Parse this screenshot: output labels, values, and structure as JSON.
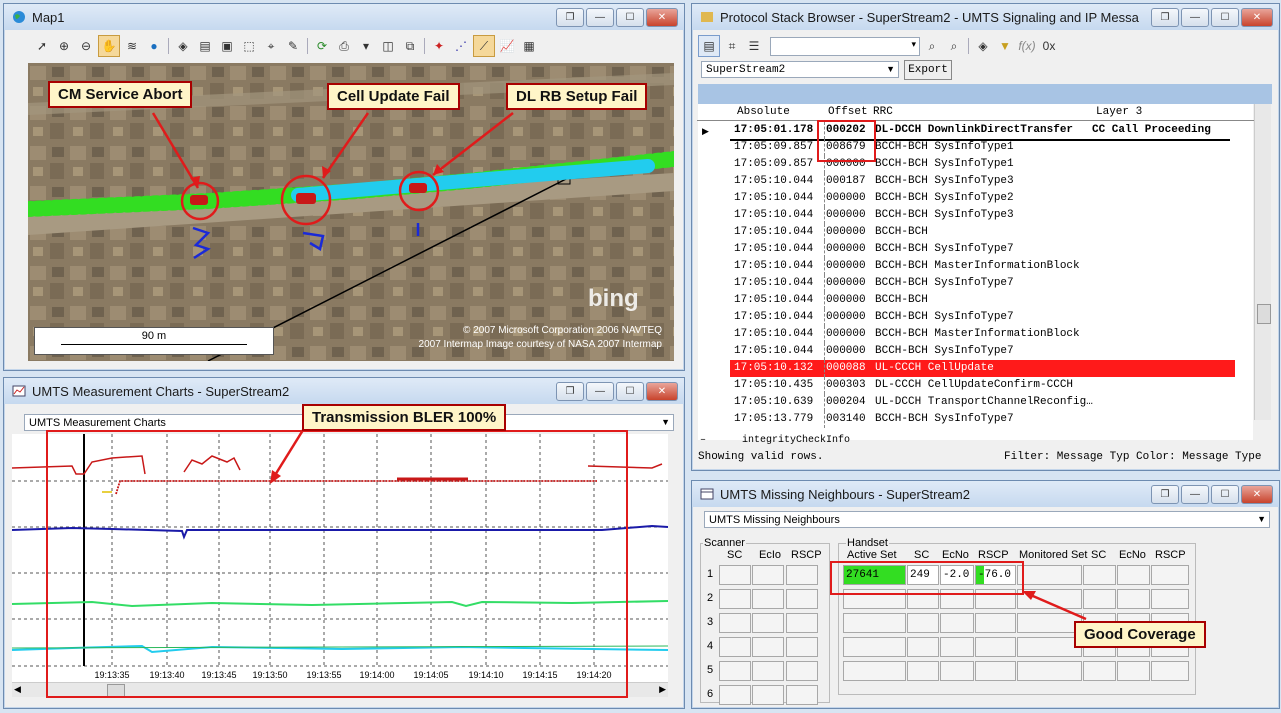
{
  "map_window": {
    "title": "Map1",
    "scale_label": "90 m",
    "bing": "bing",
    "copyright_1": "© 2007 Microsoft Corporation   2006 NAVTEQ",
    "copyright_2": "2007 Intermap  Image courtesy of NASA   2007 Intermap",
    "callouts": [
      "CM Service Abort",
      "Cell Update Fail",
      "DL RB Setup Fail"
    ]
  },
  "stack_window": {
    "title": "Protocol Stack Browser  -  SuperStream2  -  UMTS Signaling and IP Messa",
    "stream_select": "SuperStream2",
    "export_label": "Export",
    "columns": [
      "Absolute",
      "Offset",
      "RRC",
      "Layer 3"
    ],
    "rows": [
      {
        "time": "17:05:01.178",
        "offset": "000202",
        "rrc": "DL-DCCH DownlinkDirectTransfer",
        "l3": "CC Call Proceeding"
      },
      {
        "time": "17:05:09.857",
        "offset": "008679",
        "rrc": "BCCH-BCH SysInfoType1",
        "l3": ""
      },
      {
        "time": "17:05:09.857",
        "offset": "000000",
        "rrc": "BCCH-BCH SysInfoType1",
        "l3": ""
      },
      {
        "time": "17:05:10.044",
        "offset": "000187",
        "rrc": "BCCH-BCH SysInfoType3",
        "l3": ""
      },
      {
        "time": "17:05:10.044",
        "offset": "000000",
        "rrc": "BCCH-BCH SysInfoType2",
        "l3": ""
      },
      {
        "time": "17:05:10.044",
        "offset": "000000",
        "rrc": "BCCH-BCH SysInfoType3",
        "l3": ""
      },
      {
        "time": "17:05:10.044",
        "offset": "000000",
        "rrc": "BCCH-BCH",
        "l3": ""
      },
      {
        "time": "17:05:10.044",
        "offset": "000000",
        "rrc": "BCCH-BCH SysInfoType7",
        "l3": ""
      },
      {
        "time": "17:05:10.044",
        "offset": "000000",
        "rrc": "BCCH-BCH MasterInformationBlock",
        "l3": ""
      },
      {
        "time": "17:05:10.044",
        "offset": "000000",
        "rrc": "BCCH-BCH SysInfoType7",
        "l3": ""
      },
      {
        "time": "17:05:10.044",
        "offset": "000000",
        "rrc": "BCCH-BCH",
        "l3": ""
      },
      {
        "time": "17:05:10.044",
        "offset": "000000",
        "rrc": "BCCH-BCH SysInfoType7",
        "l3": ""
      },
      {
        "time": "17:05:10.044",
        "offset": "000000",
        "rrc": "BCCH-BCH MasterInformationBlock",
        "l3": ""
      },
      {
        "time": "17:05:10.044",
        "offset": "000000",
        "rrc": "BCCH-BCH SysInfoType7",
        "l3": ""
      },
      {
        "time": "17:05:10.132",
        "offset": "000088",
        "rrc": "UL-CCCH CellUpdate",
        "l3": ""
      },
      {
        "time": "17:05:10.435",
        "offset": "000303",
        "rrc": "DL-CCCH CellUpdateConfirm-CCCH",
        "l3": ""
      },
      {
        "time": "17:05:10.639",
        "offset": "000204",
        "rrc": "UL-DCCH  TransportChannelReconfig…",
        "l3": ""
      },
      {
        "time": "17:05:13.779",
        "offset": "003140",
        "rrc": "BCCH-BCH SysInfoType7",
        "l3": ""
      }
    ],
    "detail_line": "–      integrityCheckInfo",
    "status_left": "Showing valid rows.",
    "status_right": "Filter: Message Typ Color: Message Type"
  },
  "charts_window": {
    "title": "UMTS Measurement Charts - SuperStream2",
    "combo": "UMTS Measurement Charts",
    "callout": "Transmission BLER 100%",
    "time_ticks": [
      "19:13:35",
      "19:13:40",
      "19:13:45",
      "19:13:50",
      "19:13:55",
      "19:14:00",
      "19:14:05",
      "19:14:10",
      "19:14:15",
      "19:14:20"
    ]
  },
  "neighbours_window": {
    "title": "UMTS Missing Neighbours - SuperStream2",
    "combo": "UMTS Missing Neighbours",
    "scanner_label": "Scanner",
    "scanner_cols": [
      "SC",
      "EcIo",
      "RSCP"
    ],
    "handset_label": "Handset",
    "handset_cols": [
      "Active Set",
      "SC",
      "EcNo",
      "RSCP",
      "Monitored Set",
      "SC",
      "EcNo",
      "RSCP"
    ],
    "row_numbers": [
      "1",
      "2",
      "3",
      "4",
      "5",
      "6"
    ],
    "active_row": {
      "active_set": "27641",
      "sc": "249",
      "ecno": "-2.0",
      "rscp": "-76.0"
    },
    "callout": "Good Coverage"
  },
  "colors": {
    "highlight": "#ff1a1a",
    "green": "#33dd22",
    "cyan": "#22ccee",
    "callout_bg": "#fff5c8"
  }
}
